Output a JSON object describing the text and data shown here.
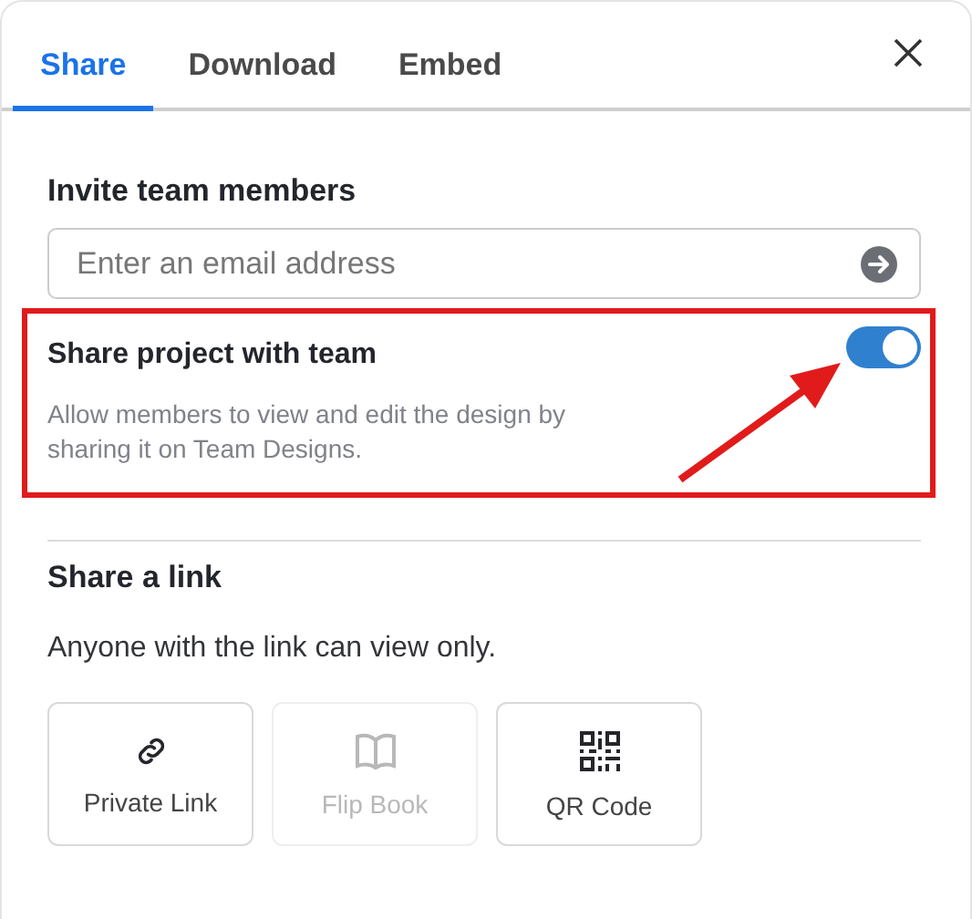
{
  "tabs": [
    {
      "label": "Share",
      "selected": true
    },
    {
      "label": "Download",
      "selected": false
    },
    {
      "label": "Embed",
      "selected": false
    }
  ],
  "invite": {
    "heading": "Invite team members",
    "placeholder": "Enter an email address"
  },
  "team_share": {
    "title": "Share project with team",
    "description": "Allow members to view and edit the design by sharing it on Team Designs.",
    "on": true
  },
  "link_section": {
    "heading": "Share a link",
    "note": "Anyone with the link can view only.",
    "options": [
      {
        "kind": "link",
        "label": "Private Link",
        "disabled": false
      },
      {
        "kind": "book",
        "label": "Flip Book",
        "disabled": true
      },
      {
        "kind": "qr",
        "label": "QR Code",
        "disabled": false
      }
    ]
  },
  "annotation": {
    "frame": true,
    "arrow": true
  }
}
